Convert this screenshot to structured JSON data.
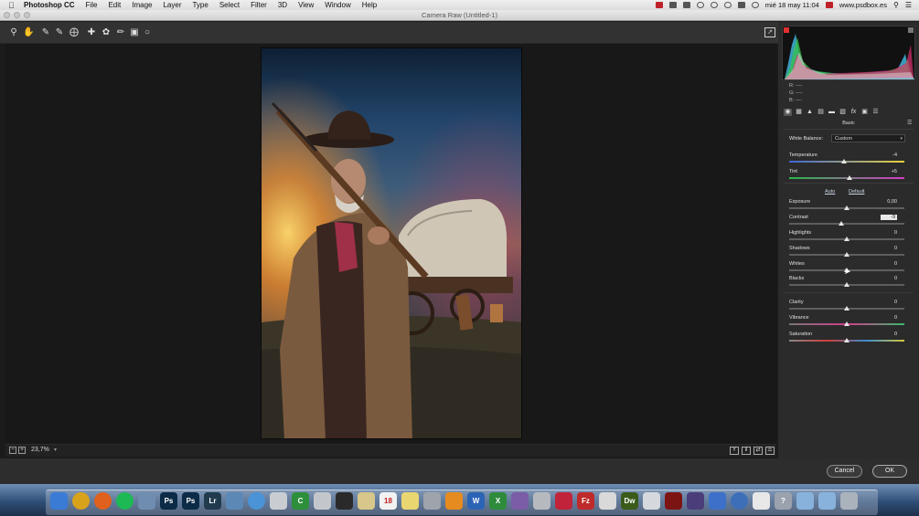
{
  "menubar": {
    "app_name": "Photoshop CC",
    "items": [
      "File",
      "Edit",
      "Image",
      "Layer",
      "Type",
      "Select",
      "Filter",
      "3D",
      "View",
      "Window",
      "Help"
    ],
    "clock": "mié 18 may  11:04",
    "site": "www.psdbox.es"
  },
  "window": {
    "title": "Camera Raw (Untitled-1)"
  },
  "toolbar": {
    "tools": [
      "zoom-icon",
      "hand-icon",
      "white-balance-icon",
      "color-sampler-icon",
      "targeted-adjustment-icon",
      "crop-icon",
      "spot-removal-icon",
      "adjustment-brush-icon",
      "graduated-filter-icon",
      "radial-filter-icon"
    ]
  },
  "footer": {
    "zoom": "23,7%"
  },
  "histogram": {
    "r_label": "R:",
    "g_label": "G:",
    "b_label": "B:",
    "r": "----",
    "g": "----",
    "b": "----"
  },
  "panel": {
    "section_title": "Basic",
    "white_balance_label": "White Balance:",
    "white_balance_value": "Custom",
    "auto_label": "Auto",
    "default_label": "Default",
    "sliders": [
      {
        "label": "Temperature",
        "value": "-4",
        "pos": 0.48
      },
      {
        "label": "Tint",
        "value": "+5",
        "pos": 0.52
      },
      {
        "label": "Exposure",
        "value": "0,00",
        "pos": 0.5
      },
      {
        "label": "Contrast",
        "value": "-9",
        "pos": 0.45
      },
      {
        "label": "Highlights",
        "value": "0",
        "pos": 0.5
      },
      {
        "label": "Shadows",
        "value": "0",
        "pos": 0.5
      },
      {
        "label": "Whites",
        "value": "0",
        "pos": 0.5
      },
      {
        "label": "Blacks",
        "value": "0",
        "pos": 0.5
      },
      {
        "label": "Clarity",
        "value": "0",
        "pos": 0.5
      },
      {
        "label": "Vibrance",
        "value": "0",
        "pos": 0.5
      },
      {
        "label": "Saturation",
        "value": "0",
        "pos": 0.5
      }
    ]
  },
  "buttons": {
    "cancel": "Cancel",
    "ok": "OK"
  },
  "dock": {
    "apps": [
      {
        "name": "finder-icon",
        "color": "#3a7bd5",
        "glyph": ""
      },
      {
        "name": "chrome-icon",
        "color": "#d9a21b",
        "glyph": ""
      },
      {
        "name": "firefox-icon",
        "color": "#e0601d",
        "glyph": ""
      },
      {
        "name": "spotify-icon",
        "color": "#1db954",
        "glyph": ""
      },
      {
        "name": "app-icon",
        "color": "#6f8db0",
        "glyph": ""
      },
      {
        "name": "photoshop-icon",
        "color": "#0b2b47",
        "glyph": "Ps"
      },
      {
        "name": "photoshop-icon",
        "color": "#0b2b47",
        "glyph": "Ps"
      },
      {
        "name": "lightroom-icon",
        "color": "#213a4d",
        "glyph": "Lr"
      },
      {
        "name": "preview-icon",
        "color": "#5c88b6",
        "glyph": ""
      },
      {
        "name": "safari-icon",
        "color": "#4a93d6",
        "glyph": ""
      },
      {
        "name": "app-icon",
        "color": "#c9ccd1",
        "glyph": ""
      },
      {
        "name": "app-icon",
        "color": "#2d8f3b",
        "glyph": "C"
      },
      {
        "name": "app-icon",
        "color": "#c3c7cc",
        "glyph": ""
      },
      {
        "name": "activity-monitor-icon",
        "color": "#2a2a2a",
        "glyph": ""
      },
      {
        "name": "app-icon",
        "color": "#d8c78a",
        "glyph": ""
      },
      {
        "name": "calendar-icon",
        "color": "#f2f2f2",
        "glyph": "18"
      },
      {
        "name": "notes-icon",
        "color": "#e9d671",
        "glyph": ""
      },
      {
        "name": "app-icon",
        "color": "#9ea4ab",
        "glyph": ""
      },
      {
        "name": "vlc-icon",
        "color": "#e58b1f",
        "glyph": ""
      },
      {
        "name": "word-icon",
        "color": "#2c64b5",
        "glyph": "W"
      },
      {
        "name": "excel-icon",
        "color": "#2e8b3c",
        "glyph": "X"
      },
      {
        "name": "app-icon",
        "color": "#7b5ca6",
        "glyph": ""
      },
      {
        "name": "app-icon",
        "color": "#b6babf",
        "glyph": ""
      },
      {
        "name": "app-icon",
        "color": "#c0233a",
        "glyph": ""
      },
      {
        "name": "filezilla-icon",
        "color": "#bf2a2a",
        "glyph": "Fz"
      },
      {
        "name": "app-icon",
        "color": "#d9d9d9",
        "glyph": ""
      },
      {
        "name": "dreamweaver-icon",
        "color": "#3a5b1a",
        "glyph": "Dw"
      },
      {
        "name": "app-icon",
        "color": "#d5d9de",
        "glyph": ""
      },
      {
        "name": "app-icon",
        "color": "#7d1414",
        "glyph": ""
      },
      {
        "name": "app-icon",
        "color": "#4b3c7a",
        "glyph": ""
      },
      {
        "name": "app-icon",
        "color": "#3d71c9",
        "glyph": ""
      },
      {
        "name": "bluetooth-icon",
        "color": "#3c6fb8",
        "glyph": ""
      },
      {
        "name": "document-icon",
        "color": "#e8e8e8",
        "glyph": ""
      },
      {
        "name": "help-icon",
        "color": "#9aa3ad",
        "glyph": "?"
      },
      {
        "name": "folder-icon",
        "color": "#88b2dc",
        "glyph": ""
      },
      {
        "name": "folder-icon",
        "color": "#88b2dc",
        "glyph": ""
      },
      {
        "name": "trash-icon",
        "color": "#aab2bb",
        "glyph": ""
      }
    ]
  }
}
